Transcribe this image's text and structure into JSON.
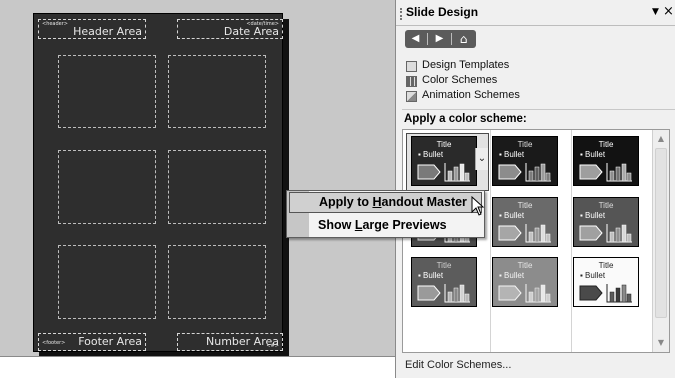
{
  "handout_master": {
    "header_tiny": "<header>",
    "header_label": "Header Area",
    "date_tiny": "<date/time>",
    "date_label": "Date Area",
    "footer_tiny": "<footer>",
    "footer_label": "Footer Area",
    "number_tiny": "<#>",
    "number_label": "Number Area"
  },
  "context_menu": {
    "item1_pre": "Apply to ",
    "item1_accel": "H",
    "item1_post": "andout Master",
    "item2_pre": "Show ",
    "item2_accel": "L",
    "item2_post": "arge Previews"
  },
  "task_pane": {
    "title": "Slide Design",
    "dropdown_glyph": "▼",
    "close_glyph": "×",
    "nav": {
      "back_glyph": "◀",
      "forward_glyph": "▶",
      "home_glyph": "⌂"
    },
    "links": [
      {
        "label": "Design Templates",
        "icon": "design-templates-icon"
      },
      {
        "label": "Color Schemes",
        "icon": "color-schemes-icon"
      },
      {
        "label": "Animation Schemes",
        "icon": "animation-schemes-icon"
      }
    ],
    "section_title": "Apply a color scheme:",
    "scheme_title_text": "Title",
    "scheme_bullet_text": "▪ Bullet",
    "bottom_link": "Edit Color Schemes..."
  },
  "color_schemes": [
    {
      "bg": "#2a2a2a",
      "title": "#ffffff",
      "text": "#ffffff",
      "accent": "#7a7a7a",
      "bar1": "#bdbdbd",
      "bar2": "#9a9a9a",
      "bar3": "#e8e8e8",
      "selected": true
    },
    {
      "bg": "#1a1a1a",
      "title": "#e0e0e0",
      "text": "#ffffff",
      "accent": "#8c8c8c",
      "bar1": "#7c7c7c",
      "bar2": "#5e5e5e",
      "bar3": "#9c9c9c",
      "selected": false
    },
    {
      "bg": "#121212",
      "title": "#ffffff",
      "text": "#ffffff",
      "accent": "#9e9e9e",
      "bar1": "#8e8e8e",
      "bar2": "#707070",
      "bar3": "#aaaaaa",
      "selected": false
    },
    {
      "bg": "#4a4a4a",
      "title": "#e0e0e0",
      "text": "#ffffff",
      "accent": "#9a9a9a",
      "bar1": "#bcbcbc",
      "bar2": "#8a8a8a",
      "bar3": "#d4d4d4",
      "selected": false
    },
    {
      "bg": "#6a6a6a",
      "title": "#e6e6e6",
      "text": "#ffffff",
      "accent": "#a6a6a6",
      "bar1": "#c2c2c2",
      "bar2": "#9a9a9a",
      "bar3": "#dedede",
      "selected": false
    },
    {
      "bg": "#555555",
      "title": "#dddddd",
      "text": "#ffffff",
      "accent": "#a0a0a0",
      "bar1": "#bfbfbf",
      "bar2": "#8e8e8e",
      "bar3": "#d8d8d8",
      "selected": false
    },
    {
      "bg": "#5c5c5c",
      "title": "#d0d0d0",
      "text": "#ffffff",
      "accent": "#9a9a9a",
      "bar1": "#b8b8b8",
      "bar2": "#888888",
      "bar3": "#d2d2d2",
      "selected": false
    },
    {
      "bg": "#8c8c8c",
      "title": "#e6e6e6",
      "text": "#f4f4f4",
      "accent": "#b4b4b4",
      "bar1": "#cfcfcf",
      "bar2": "#a6a6a6",
      "bar3": "#e8e8e8",
      "selected": false
    },
    {
      "bg": "#fafafa",
      "title": "#222222",
      "text": "#222222",
      "accent": "#4a4a4a",
      "bar1": "#5a5a5a",
      "bar2": "#3a3a3a",
      "bar3": "#8a8a8a",
      "selected": false
    }
  ]
}
